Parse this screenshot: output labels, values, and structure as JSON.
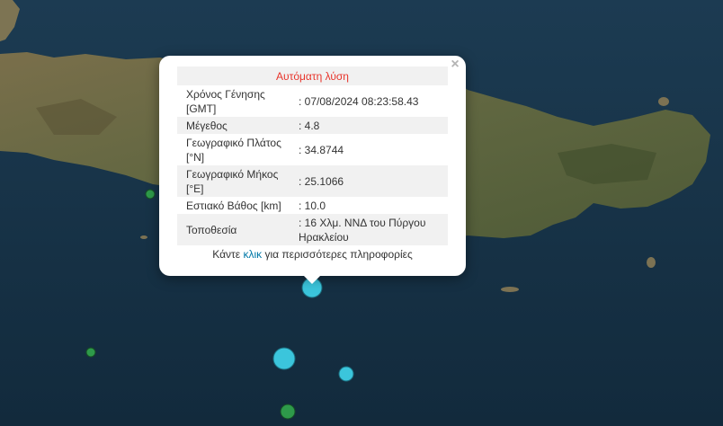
{
  "popup": {
    "header": "Αυτόματη λύση",
    "close_symbol": "×",
    "rows": [
      {
        "label": "Χρόνος Γένησης [GMT]",
        "value": ": 07/08/2024 08:23:58.43"
      },
      {
        "label": "Μέγεθος",
        "value": ": 4.8"
      },
      {
        "label": "Γεωγραφικό Πλάτος [°N]",
        "value": ": 34.8744"
      },
      {
        "label": "Γεωγραφικό Μήκος [°E]",
        "value": ": 25.1066"
      },
      {
        "label": "Εστιακό Βάθος [km]",
        "value": ": 10.0"
      },
      {
        "label": "Τοποθεσία",
        "value": ": 16 Χλμ. ΝΝΔ του Πύργου Ηρακλείου"
      }
    ],
    "more_prefix": "Κάντε ",
    "more_link": "κλικ",
    "more_suffix": " για περισσότερες πληροφορίες"
  },
  "colors": {
    "sea": "#1d3a4f",
    "land": "#6e6a46",
    "marker_cyan": "#3bc5dc",
    "marker_green": "#2e9a4a",
    "header_red": "#e8342b",
    "link_blue": "#0078a8"
  },
  "markers": [
    {
      "type": "earthquake",
      "color": "cyan",
      "size": "large",
      "selected": true
    },
    {
      "type": "earthquake",
      "color": "cyan",
      "size": "large"
    },
    {
      "type": "earthquake",
      "color": "cyan",
      "size": "small"
    },
    {
      "type": "earthquake",
      "color": "green",
      "size": "small"
    },
    {
      "type": "earthquake",
      "color": "green",
      "size": "small"
    },
    {
      "type": "earthquake",
      "color": "green",
      "size": "small"
    }
  ]
}
